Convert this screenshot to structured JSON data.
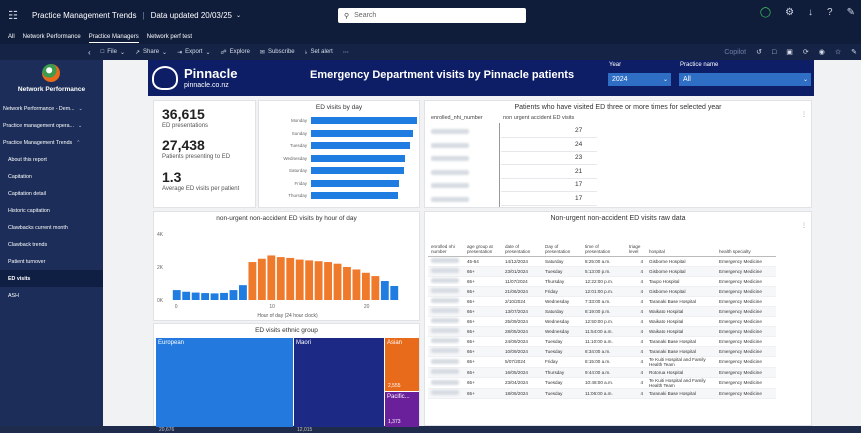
{
  "topbar": {
    "app_title": "Practice Management Trends",
    "updated": "Data updated 20/03/25",
    "search_placeholder": "Search"
  },
  "navbar": {
    "items": [
      "All",
      "Network Performance",
      "Practice Managers",
      "Network perf test"
    ]
  },
  "toolbar": {
    "items": [
      "File",
      "Share",
      "Export",
      "Explore",
      "Subscribe",
      "Set alert",
      "⋯"
    ],
    "copilot": "Copilot"
  },
  "sidebar": {
    "brand": "Network Performance",
    "items": [
      {
        "label": "Network Performance - Dem...",
        "group": true,
        "chev": "⌄"
      },
      {
        "label": "Practice management opera...",
        "group": true,
        "chev": "⌄"
      },
      {
        "label": "Practice Management Trends",
        "group": true,
        "chev": "⌃"
      },
      {
        "label": "About this report"
      },
      {
        "label": "Capitation"
      },
      {
        "label": "Capitation detail"
      },
      {
        "label": "Historic capitation"
      },
      {
        "label": "Clawbacks current month"
      },
      {
        "label": "Clawback trends"
      },
      {
        "label": "Patient turnover"
      },
      {
        "label": "ED visits",
        "active": true
      },
      {
        "label": "ASH"
      }
    ]
  },
  "header": {
    "logo_name": "Pinnacle",
    "logo_url": "pinnacle.co.nz",
    "title": "Emergency Department visits by Pinnacle patients",
    "year_label": "Year",
    "year_value": "2024",
    "practice_label": "Practice name",
    "practice_value": "All"
  },
  "kpis": [
    {
      "value": "36,615",
      "label": "ED presentations"
    },
    {
      "value": "27,438",
      "label": "Patients presenting to ED"
    },
    {
      "value": "1.3",
      "label": "Average ED visits per patient"
    }
  ],
  "visits_by_day": {
    "title": "ED visits by day",
    "days": [
      "Monday",
      "Sunday",
      "Tuesday",
      "Wednesday",
      "Saturday",
      "Friday",
      "Thursday"
    ],
    "values": [
      100,
      96,
      93,
      89,
      88,
      83,
      82
    ]
  },
  "repeat_patients": {
    "title": "Patients who have visited ED three or more times for selected year",
    "col1": "enrolled_nhi_number",
    "col2": "non urgent accident ED visits",
    "values": [
      "27",
      "24",
      "23",
      "21",
      "17",
      "17"
    ]
  },
  "chart_data": {
    "type": "bar",
    "title": "non-urgent non-accident ED visits by hour of day",
    "xlabel": "Hour of day (24 hour clock)",
    "ylabel": "",
    "x_ticks": [
      "0",
      "10",
      "20"
    ],
    "y_ticks": [
      "0K",
      "2K",
      "4K"
    ],
    "ylim": [
      0,
      4000
    ],
    "categories": [
      "0",
      "1",
      "2",
      "3",
      "4",
      "5",
      "6",
      "7",
      "8",
      "9",
      "10",
      "11",
      "12",
      "13",
      "14",
      "15",
      "16",
      "17",
      "18",
      "19",
      "20",
      "21",
      "22",
      "23"
    ],
    "values": [
      600,
      500,
      450,
      420,
      400,
      430,
      600,
      900,
      2300,
      2500,
      2700,
      2600,
      2550,
      2450,
      2400,
      2350,
      2300,
      2200,
      2000,
      1850,
      1650,
      1450,
      1150,
      850
    ],
    "highlight_range": [
      8,
      21
    ],
    "colors": {
      "base": "#1f7ce0",
      "highlight": "#f07a2b"
    }
  },
  "raw_data": {
    "title": "Non-urgent non-accident ED visits raw data",
    "columns": [
      "enrolled nhi number",
      "age group at presentation",
      "date of presentation",
      "Day of presentation",
      "time of presentation",
      "triage level",
      "hospital",
      "health specialty"
    ],
    "rows": [
      [
        "45-64",
        "14/12/2024",
        "Saturday",
        "8:25:00 a.m.",
        "4",
        "Gisborne Hospital",
        "Emergency Medicine"
      ],
      [
        "65+",
        "23/01/2024",
        "Tuesday",
        "5:13:00 p.m.",
        "4",
        "Gisborne Hospital",
        "Emergency Medicine"
      ],
      [
        "65+",
        "11/07/2024",
        "Thursday",
        "12:22:00 p.m.",
        "4",
        "Taupo Hospital",
        "Emergency Medicine"
      ],
      [
        "65+",
        "21/06/2024",
        "Friday",
        "12:01:00 p.m.",
        "4",
        "Gisborne Hospital",
        "Emergency Medicine"
      ],
      [
        "65+",
        "2/10/2024",
        "Wednesday",
        "7:33:00 a.m.",
        "4",
        "Taranaki Base Hospital",
        "Emergency Medicine"
      ],
      [
        "65+",
        "13/07/2024",
        "Saturday",
        "8:19:00 p.m.",
        "4",
        "Waikato Hospital",
        "Emergency Medicine"
      ],
      [
        "65+",
        "25/09/2024",
        "Wednesday",
        "12:50:00 p.m.",
        "4",
        "Waikato Hospital",
        "Emergency Medicine"
      ],
      [
        "65+",
        "28/05/2024",
        "Wednesday",
        "11:54:00 a.m.",
        "4",
        "Waikato Hospital",
        "Emergency Medicine"
      ],
      [
        "65+",
        "24/09/2024",
        "Tuesday",
        "11:10:00 a.m.",
        "4",
        "Taranaki Base Hospital",
        "Emergency Medicine"
      ],
      [
        "65+",
        "10/09/2024",
        "Tuesday",
        "8:34:00 a.m.",
        "4",
        "Taranaki Base Hospital",
        "Emergency Medicine"
      ],
      [
        "65+",
        "5/07/2024",
        "Friday",
        "8:15:00 a.m.",
        "4",
        "Te Kuiti Hospital and Family Health Team",
        "Emergency Medicine"
      ],
      [
        "65+",
        "16/05/2024",
        "Thursday",
        "9:44:00 a.m.",
        "4",
        "Rotorua Hospital",
        "Emergency Medicine"
      ],
      [
        "65+",
        "23/04/2024",
        "Tuesday",
        "10:48:00 a.m.",
        "4",
        "Te Kuiti Hospital and Family Health Team",
        "Emergency Medicine"
      ],
      [
        "65+",
        "18/06/2024",
        "Tuesday",
        "11:06:00 a.m.",
        "4",
        "Taranaki Base Hospital",
        "Emergency Medicine"
      ]
    ]
  },
  "ethnic": {
    "title": "ED visits ethnic group",
    "groups": [
      {
        "name": "European",
        "value": "20,676",
        "color": "#2379de"
      },
      {
        "name": "Maori",
        "value": "12,015",
        "color": "#1c2a86"
      },
      {
        "name": "Asian",
        "value": "2,555",
        "color": "#e86a1b"
      },
      {
        "name": "Pacific...",
        "value": "1,373",
        "color": "#6a1f9b"
      }
    ]
  }
}
